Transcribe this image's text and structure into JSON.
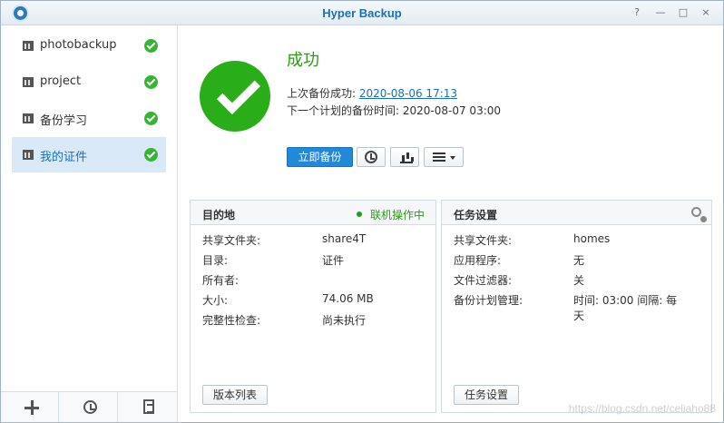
{
  "window": {
    "title": "Hyper Backup",
    "controls": [
      "?",
      "—",
      "□",
      "×"
    ]
  },
  "sidebar": {
    "tasks": [
      {
        "label": "photobackup",
        "status": "success",
        "active": false
      },
      {
        "label": "project",
        "status": "success",
        "active": false
      },
      {
        "label": "备份学习",
        "status": "success",
        "active": false
      },
      {
        "label": "我的证件",
        "status": "success",
        "active": true
      }
    ]
  },
  "status": {
    "title": "成功",
    "last_label": "上次备份成功:",
    "last_value": "2020-08-06 17:13",
    "next_label": "下一个计划的备份时间:",
    "next_value": "2020-08-07 03:00"
  },
  "toolbar": {
    "backup_now": "立即备份"
  },
  "destination": {
    "title": "目的地",
    "status": "联机操作中",
    "rows": [
      {
        "key": "共享文件夹:",
        "value": "share4T"
      },
      {
        "key": "目录:",
        "value": "证件"
      },
      {
        "key": "所有者:",
        "value": ""
      },
      {
        "key": "大小:",
        "value": "74.06 MB"
      },
      {
        "key": "完整性检查:",
        "value": "尚未执行"
      }
    ],
    "button": "版本列表"
  },
  "task_settings": {
    "title": "任务设置",
    "rows": [
      {
        "key": "共享文件夹:",
        "value": "homes"
      },
      {
        "key": "应用程序:",
        "value": "无"
      },
      {
        "key": "文件过滤器:",
        "value": "关"
      },
      {
        "key": "备份计划管理:",
        "value": "时间: 03:00 间隔: 每天"
      }
    ],
    "button": "任务设置"
  },
  "watermark": "https://blog.csdn.net/celiaho88",
  "colors": {
    "accent": "#1f6fb5",
    "success": "#2a9d13",
    "primary_button": "#2488d8"
  },
  "icons": [
    "hyper-backup-app-icon",
    "task-icon",
    "check-icon",
    "plus-icon",
    "history-icon",
    "log-icon",
    "restore-icon",
    "chart-icon",
    "menu-icon",
    "settings-icon"
  ]
}
